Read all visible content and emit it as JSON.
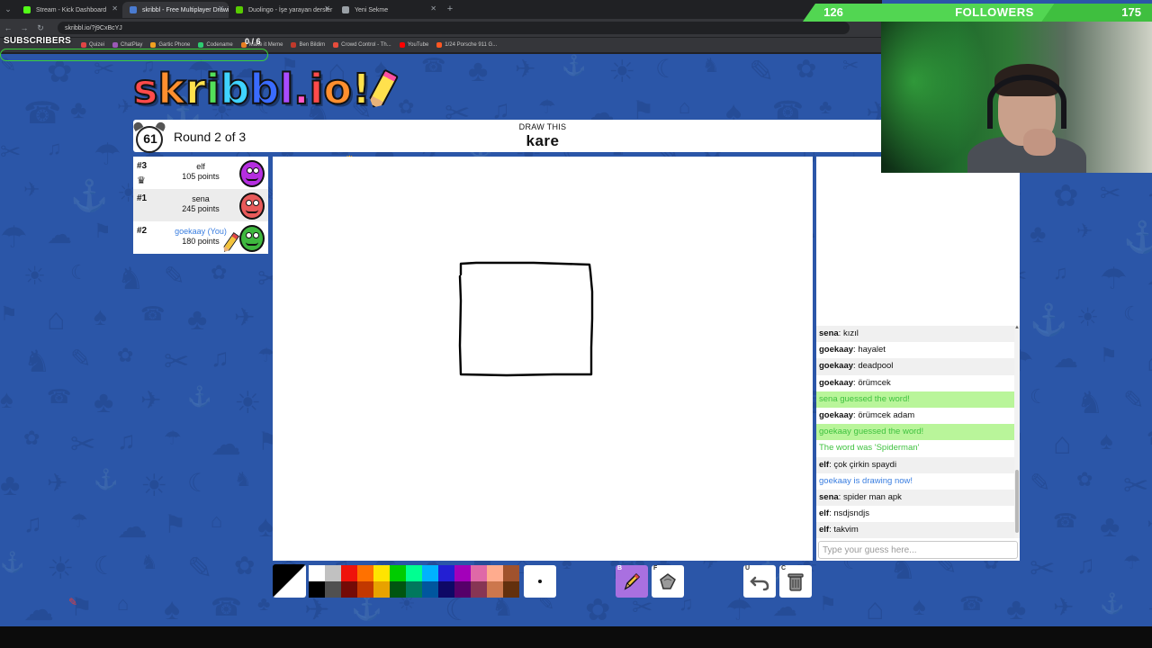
{
  "browser": {
    "tabs": [
      {
        "title": "Stream - Kick Dashboard",
        "favicon_color": "#53fc18",
        "active": false
      },
      {
        "title": "skribbl - Free Multiplayer Drawin",
        "favicon_color": "#4a7bd0",
        "active": true
      },
      {
        "title": "Duolingo - İşe yarayan dersler",
        "favicon_color": "#58cc02",
        "active": false
      },
      {
        "title": "Yeni Sekme",
        "favicon_color": "#9aa0a6",
        "active": false
      }
    ],
    "new_tab": "+",
    "address": "skribbl.io/?j9CxBcYJ",
    "bookmarks": [
      {
        "label": "Quizei",
        "color": "#e04545"
      },
      {
        "label": "ChatPlay",
        "color": "#9b59b6"
      },
      {
        "label": "Gartic Phone",
        "color": "#f0a020"
      },
      {
        "label": "Codename",
        "color": "#2ecc71"
      },
      {
        "label": "Make it Meme",
        "color": "#e67e22"
      },
      {
        "label": "Ben Bildim",
        "color": "#c0392b"
      },
      {
        "label": "Crowd Control - Th...",
        "color": "#e74c3c"
      },
      {
        "label": "YouTube",
        "color": "#ff0000"
      },
      {
        "label": "1/24 Porsche 911 G...",
        "color": "#ff5722"
      }
    ]
  },
  "overlay": {
    "subscribers_label": "SUBSCRIBERS",
    "subscribers_count": "0 / 6",
    "followers_current": "126",
    "followers_label": "FOLLOWERS",
    "followers_goal": "175",
    "followers_progress": 0.72,
    "accent": "#52d652"
  },
  "game": {
    "logo_letters": [
      {
        "ch": "s",
        "color": "#ff4b4b"
      },
      {
        "ch": "k",
        "color": "#ff8f2e"
      },
      {
        "ch": "r",
        "color": "#ffe14d"
      },
      {
        "ch": "i",
        "color": "#53e05a"
      },
      {
        "ch": "b",
        "color": "#3fd3ff"
      },
      {
        "ch": "b",
        "color": "#3a6bff"
      },
      {
        "ch": "l",
        "color": "#a94bff"
      },
      {
        "ch": ".",
        "color": "#ff57c8"
      },
      {
        "ch": "i",
        "color": "#ff4b4b"
      },
      {
        "ch": "o",
        "color": "#ff8f2e"
      },
      {
        "ch": "!",
        "color": "#ffe14d"
      }
    ],
    "timer": "61",
    "round_text": "Round 2 of 3",
    "draw_hint": "DRAW THIS",
    "word": "kare",
    "players": [
      {
        "rank": "#3",
        "name": "elf",
        "points": "105 points",
        "is_you": false,
        "avatar_color": "#b52ee0"
      },
      {
        "rank": "#1",
        "name": "sena",
        "points": "245 points",
        "is_you": false,
        "avatar_color": "#e85a5a"
      },
      {
        "rank": "#2",
        "name": "goekaay (You)",
        "points": "180 points",
        "is_you": true,
        "avatar_color": "#3fb83f"
      }
    ]
  },
  "chat": {
    "messages": [
      {
        "author": "sena",
        "text": "kızıl",
        "kind": "normal"
      },
      {
        "author": "goekaay",
        "text": "hayalet",
        "kind": "normal"
      },
      {
        "author": "goekaay",
        "text": "deadpool",
        "kind": "normal"
      },
      {
        "author": "goekaay",
        "text": "örümcek",
        "kind": "normal"
      },
      {
        "author": "",
        "text": "sena guessed the word!",
        "kind": "guessed"
      },
      {
        "author": "goekaay",
        "text": "örümcek adam",
        "kind": "normal"
      },
      {
        "author": "",
        "text": "goekaay guessed the word!",
        "kind": "guessed"
      },
      {
        "author": "",
        "text": "The word was 'Spiderman'",
        "kind": "system-green"
      },
      {
        "author": "elf",
        "text": "çok çirkin spaydi",
        "kind": "normal"
      },
      {
        "author": "",
        "text": "goekaay is drawing now!",
        "kind": "system-blue"
      },
      {
        "author": "sena",
        "text": "spider man apk",
        "kind": "normal"
      },
      {
        "author": "elf",
        "text": "nsdjsndjs",
        "kind": "normal"
      },
      {
        "author": "elf",
        "text": "takvim",
        "kind": "normal"
      }
    ],
    "placeholder": "Type your guess here..."
  },
  "toolbar": {
    "palette": [
      "#ffffff",
      "#c1c1c1",
      "#ef130b",
      "#ff7100",
      "#ffe400",
      "#00cc00",
      "#00ff91",
      "#00b2ff",
      "#231fd3",
      "#a300ba",
      "#df69a7",
      "#ffac8e",
      "#a0522d",
      "#000000",
      "#505050",
      "#740b07",
      "#c23800",
      "#e8a200",
      "#005510",
      "#00785d",
      "#00569e",
      "#0e0865",
      "#550069",
      "#873554",
      "#cc774d",
      "#63300d"
    ],
    "tools": {
      "pencil_key": "B",
      "fill_key": "F",
      "undo_key": "U",
      "clear_key": "C"
    }
  }
}
